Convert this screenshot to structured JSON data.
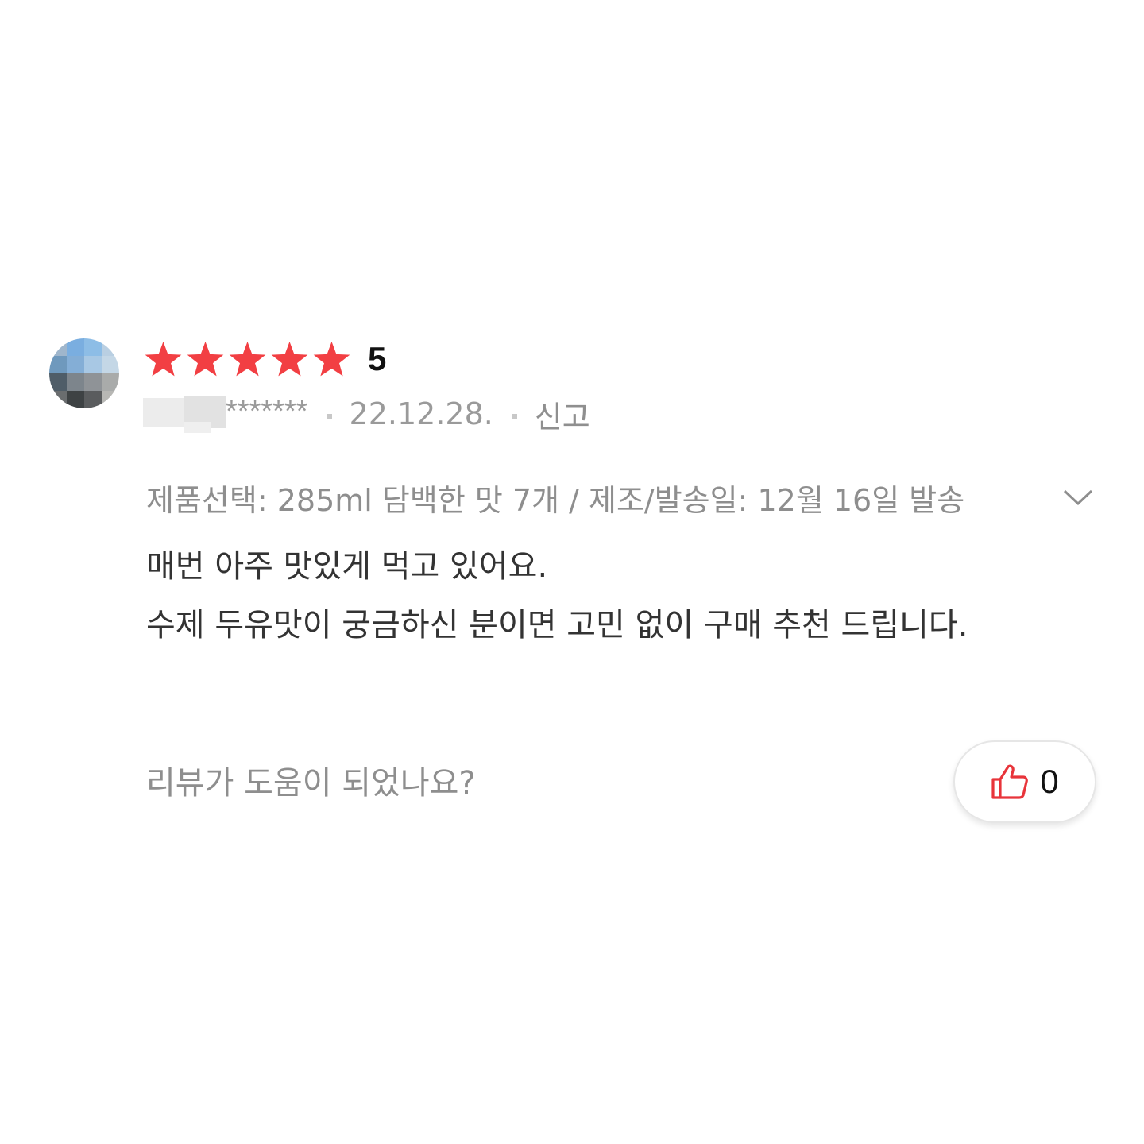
{
  "review": {
    "rating_value": "5",
    "stars_filled": 5,
    "stars_total": 5,
    "star_color": "#f23f43",
    "masked_name_suffix": "*******",
    "date": "22.12.28.",
    "report_label": "신고",
    "options_text": "제품선택: 285ml 담백한 맛 7개 / 제조/발송일: 12월 16일 발송",
    "body_lines": [
      "매번 아주 맛있게 먹고 있어요.",
      "수제 두유맛이 궁금하신 분이면 고민 없이 구매 추천 드립니다."
    ],
    "helpful_question": "리뷰가 도움이 되었나요?",
    "like_count": "0",
    "like_icon": "thumbs-up-icon",
    "like_icon_color": "#e8343a",
    "expand_icon": "chevron-down-icon",
    "avatar_colors": [
      "#9fb6cc",
      "#7aaee0",
      "#8dbde6",
      "#b9cfe2",
      "#6f99bd",
      "#84aed6",
      "#a8c8e4",
      "#c4d7e6",
      "#4f5d68",
      "#7d858c",
      "#8f9397",
      "#a9abaa",
      "#6a6d6f",
      "#3e4244",
      "#5a5c5e",
      "#b7b7b4"
    ]
  }
}
